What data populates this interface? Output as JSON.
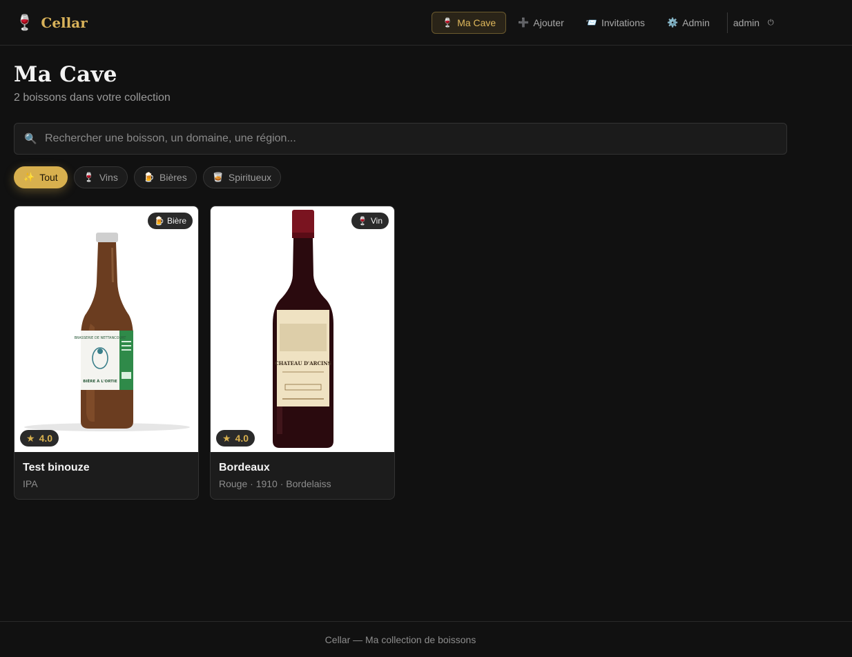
{
  "app": {
    "name": "Cellar",
    "logo_icon": "🍷"
  },
  "nav": {
    "items": [
      {
        "icon": "🍷",
        "label": "Ma Cave"
      },
      {
        "icon": "➕",
        "label": "Ajouter"
      },
      {
        "icon": "📨",
        "label": "Invitations"
      },
      {
        "icon": "⚙️",
        "label": "Admin"
      }
    ],
    "user": "admin",
    "logout_icon": "⏻"
  },
  "page": {
    "title": "Ma Cave",
    "subtitle": "2 boissons dans votre collection"
  },
  "search": {
    "icon": "🔍",
    "placeholder": "Rechercher une boisson, un domaine, une région..."
  },
  "filters": [
    {
      "icon": "✨",
      "label": "Tout"
    },
    {
      "icon": "🍷",
      "label": "Vins"
    },
    {
      "icon": "🍺",
      "label": "Bières"
    },
    {
      "icon": "🥃",
      "label": "Spiritueux"
    }
  ],
  "cards": [
    {
      "name": "Test binouze",
      "meta": "IPA",
      "type_icon": "🍺",
      "type_label": "Bière",
      "rating": "4.0",
      "star": "★",
      "label_text": "BIÈRE À L'ORTIE"
    },
    {
      "name": "Bordeaux",
      "meta": "Rouge · 1910 · Bordelaiss",
      "type_icon": "🍷",
      "type_label": "Vin",
      "rating": "4.0",
      "star": "★",
      "label_text": "CHATEAU D'ARCINS"
    }
  ],
  "footer": {
    "text": "Cellar — Ma collection de boissons"
  },
  "colors": {
    "accent": "#d8b04e",
    "background": "#111111",
    "card": "#1c1c1c"
  }
}
